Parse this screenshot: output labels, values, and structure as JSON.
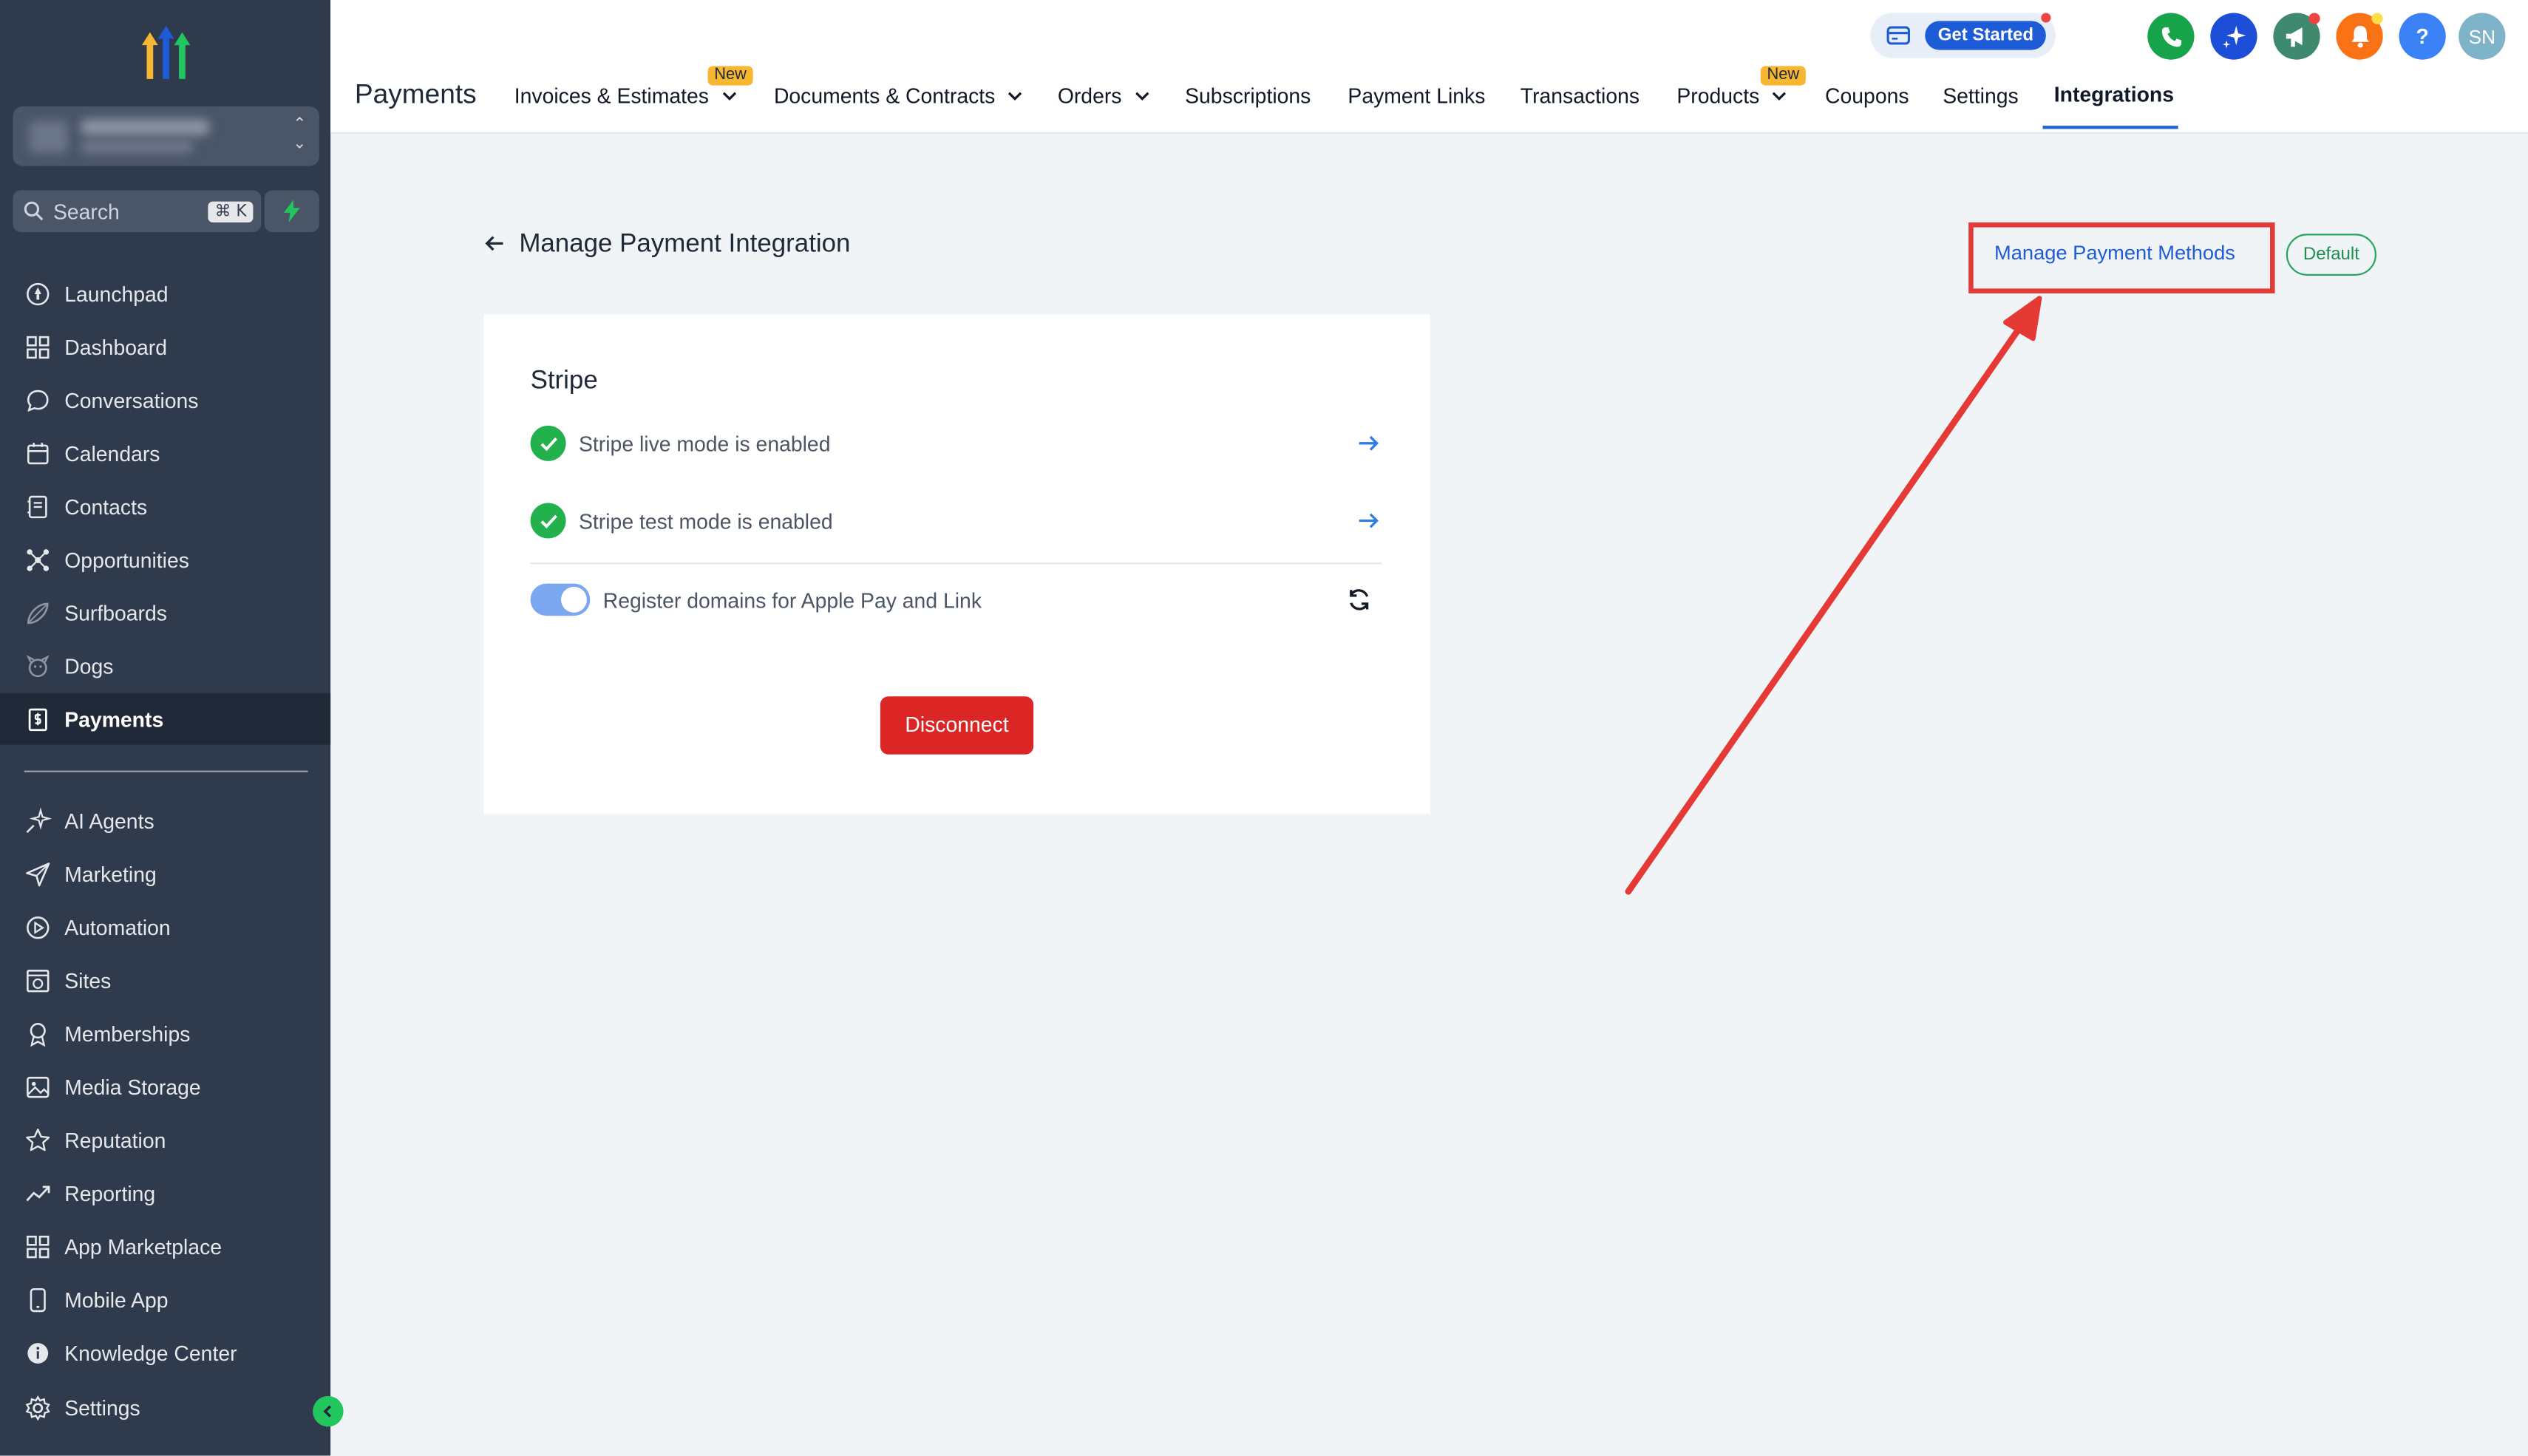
{
  "sidebar": {
    "search_label": "Search",
    "search_shortcut": "⌘ K",
    "items_top": [
      {
        "label": "Launchpad",
        "icon": "rocket-icon"
      },
      {
        "label": "Dashboard",
        "icon": "grid-icon"
      },
      {
        "label": "Conversations",
        "icon": "chat-icon"
      },
      {
        "label": "Calendars",
        "icon": "calendar-icon"
      },
      {
        "label": "Contacts",
        "icon": "contacts-icon"
      },
      {
        "label": "Opportunities",
        "icon": "network-icon"
      },
      {
        "label": "Surfboards",
        "icon": "surfboard-icon"
      },
      {
        "label": "Dogs",
        "icon": "dog-icon"
      },
      {
        "label": "Payments",
        "icon": "payments-icon"
      }
    ],
    "items_bottom": [
      {
        "label": "AI Agents",
        "icon": "sparkle-icon"
      },
      {
        "label": "Marketing",
        "icon": "send-icon"
      },
      {
        "label": "Automation",
        "icon": "automation-icon"
      },
      {
        "label": "Sites",
        "icon": "sites-icon"
      },
      {
        "label": "Memberships",
        "icon": "award-icon"
      },
      {
        "label": "Media Storage",
        "icon": "image-icon"
      },
      {
        "label": "Reputation",
        "icon": "star-icon"
      },
      {
        "label": "Reporting",
        "icon": "trend-icon"
      },
      {
        "label": "App Marketplace",
        "icon": "apps-icon"
      },
      {
        "label": "Mobile App",
        "icon": "phone-icon"
      },
      {
        "label": "Knowledge Center",
        "icon": "info-icon"
      }
    ],
    "settings_label": "Settings",
    "active_item": "Payments"
  },
  "header": {
    "title": "Payments",
    "tabs": [
      {
        "label": "Invoices & Estimates",
        "badge": "New",
        "dropdown": true
      },
      {
        "label": "Documents & Contracts",
        "dropdown": true
      },
      {
        "label": "Orders",
        "dropdown": true
      },
      {
        "label": "Subscriptions"
      },
      {
        "label": "Payment Links"
      },
      {
        "label": "Transactions"
      },
      {
        "label": "Products",
        "badge": "New",
        "dropdown": true
      },
      {
        "label": "Coupons"
      },
      {
        "label": "Settings"
      },
      {
        "label": "Integrations",
        "active": true
      }
    ],
    "get_started": "Get Started",
    "help": "?",
    "avatar": "SN"
  },
  "main": {
    "title": "Manage Payment Integration",
    "manage_methods_link": "Manage Payment Methods",
    "default_badge": "Default",
    "card": {
      "title": "Stripe",
      "live_mode": "Stripe live mode is enabled",
      "test_mode": "Stripe test mode is enabled",
      "register_domains": "Register domains for Apple Pay and Link",
      "register_enabled": true,
      "disconnect": "Disconnect"
    }
  },
  "colors": {
    "sidebar_bg": "#2f3a4c",
    "accent_blue": "#1e5bd6",
    "success_green": "#22b14c",
    "danger_red": "#dc2626",
    "annotation_red": "#e53935"
  }
}
